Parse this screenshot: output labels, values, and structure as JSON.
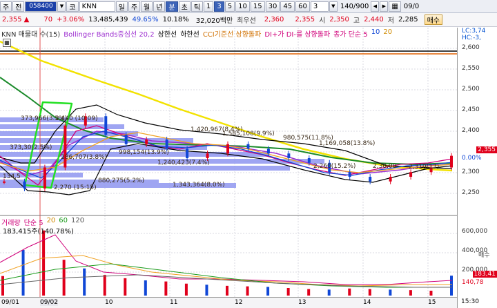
{
  "toolbar1": {
    "tabs": [
      "주",
      "전"
    ],
    "code": "058400",
    "market": "코",
    "name": "KNN",
    "periods": [
      "일",
      "주",
      "월",
      "년",
      "분",
      "초",
      "틱"
    ],
    "selected_period": "분",
    "intervals": [
      "1",
      "3",
      "5",
      "10",
      "15",
      "30",
      "45",
      "60"
    ],
    "selected_interval": "3",
    "custom_value": "3",
    "count": "140/900",
    "right_date": "09/0"
  },
  "toolbar2": {
    "price": "2,355",
    "change": "70",
    "rate": "+3.06%",
    "volume": "13,485,439",
    "vol_ratio": "49.65%",
    "turnover": "10.18%",
    "amount": "32,020백만",
    "best_sell_label": "최우선",
    "best_sell": "2,360",
    "best_buy": "2,355",
    "open_label": "시",
    "open": "2,350",
    "high_label": "고",
    "high": "2,440",
    "low_label": "저",
    "low": "2,285",
    "order_label": "매수"
  },
  "legend_price": {
    "items": [
      {
        "text": "KNN 매물대 수(15)",
        "color": "#333333"
      },
      {
        "text": "Bollinger Bands중심선 20,2",
        "color": "#9d2fd0"
      },
      {
        "text": "상한선",
        "color": "#000000"
      },
      {
        "text": "하한선",
        "color": "#000000"
      },
      {
        "text": "CCI기준선 상향돌파",
        "color": "#d07000"
      },
      {
        "text": "DI+가 DI-를 상향돌파",
        "color": "#d0007a"
      },
      {
        "text": "종가 단순 5",
        "color": "#d0007a"
      },
      {
        "text": "10",
        "color": "#1047d6"
      },
      {
        "text": "20",
        "color": "#d08a00"
      }
    ],
    "right_labels": [
      "LC:3,74",
      "HC:-3,"
    ]
  },
  "legend_volume": {
    "items": [
      {
        "text": "거래량",
        "color": "#d0007a"
      },
      {
        "text": "단순 5",
        "color": "#d0007a"
      },
      {
        "text": "20",
        "color": "#d08a00"
      },
      {
        "text": "60",
        "color": "#1a9a1a"
      },
      {
        "text": "120",
        "color": "#555555"
      }
    ],
    "value": "183,415주(140.78%)"
  },
  "price_axis": {
    "ticks": [
      "2,600",
      "2,550",
      "2,500",
      "2,450",
      "2,400",
      "2,355",
      "0.00%",
      "2,300",
      "2,250"
    ],
    "current_tag": "2,355",
    "top_tag": "720"
  },
  "volume_axis": {
    "ticks": [
      "600,000",
      "400,000",
      "200,000"
    ],
    "unit": "매수",
    "value_tags": [
      "183,41",
      "140,78"
    ]
  },
  "x_axis": {
    "labels": [
      "09/01",
      "09/02",
      "10",
      "11",
      "12",
      "13",
      "14",
      "15",
      "15:30"
    ]
  },
  "annotations": [
    "373,966(3.5%)",
    "373,30(2.5%)",
    "134,5",
    "2,270 (15:15)",
    "2,440 (10:09)",
    "286,707(3.8%)",
    "998,154(13.9%)",
    "880,275(5.2%)",
    "1,240,423(7.4%)",
    "1,343,364(8.0%)",
    "1,420,967(8.4%)",
    "1,585,108(9.9%)",
    "980,575(11.8%)",
    "1,169,058(13.8%)",
    "2,260(15.2%)",
    "2,30.00",
    "2,310(13)"
  ],
  "chart_data": [
    {
      "type": "line",
      "title": "",
      "series": [
        {
          "name": "Price",
          "values": [
            2300,
            2285,
            2330,
            2420,
            2440,
            2400,
            2380,
            2390,
            2370,
            2350,
            2360,
            2380,
            2370,
            2360,
            2350,
            2340,
            2320,
            2310,
            2300,
            2310,
            2320,
            2330,
            2355
          ]
        },
        {
          "name": "Bollinger Bands중심선 20,2",
          "values": [
            2330,
            2320,
            2330,
            2370,
            2390,
            2395,
            2390,
            2385,
            2380,
            2375,
            2370,
            2368,
            2365,
            2360,
            2355,
            2350,
            2340,
            2330,
            2320,
            2320,
            2325,
            2330,
            2338
          ]
        },
        {
          "name": "상한선",
          "values": [
            2390,
            2390,
            2440,
            2470,
            2450,
            2430,
            2410,
            2400,
            2395,
            2390,
            2390,
            2390,
            2385,
            2380,
            2370,
            2360,
            2350,
            2345,
            2345,
            2345,
            2350,
            2350,
            2355
          ]
        },
        {
          "name": "하한선",
          "values": [
            2280,
            2260,
            2250,
            2270,
            2320,
            2350,
            2360,
            2360,
            2355,
            2350,
            2345,
            2340,
            2335,
            2330,
            2320,
            2310,
            2300,
            2290,
            2285,
            2290,
            2300,
            2310,
            2320
          ]
        }
      ],
      "ylim": [
        2230,
        2630
      ]
    },
    {
      "type": "bar",
      "title": "",
      "series": [
        {
          "name": "거래량",
          "values": [
            180000,
            420000,
            600000,
            330000,
            250000,
            190000,
            160000,
            140000,
            130000,
            110000,
            100000,
            90000,
            85000,
            80000,
            70000,
            60000,
            55000,
            65000,
            60000,
            55000,
            50000,
            45000,
            183415
          ]
        }
      ],
      "ylim": [
        0,
        700000
      ]
    }
  ]
}
